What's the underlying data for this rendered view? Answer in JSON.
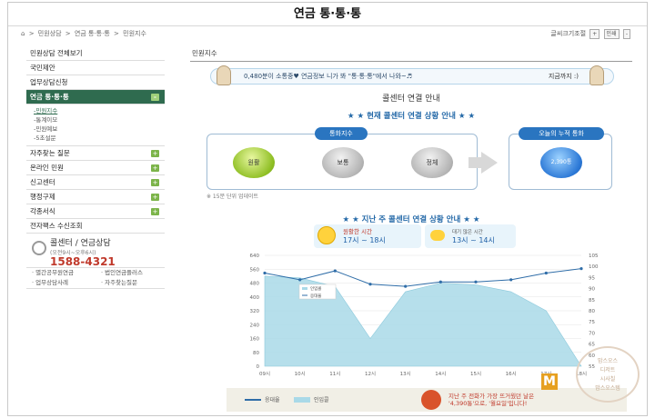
{
  "page": {
    "title": "연금 통·통·통"
  },
  "breadcrumb": [
    "⌂",
    ">",
    "민원상담",
    ">",
    "연금 통·통·통",
    ">",
    "민원지수"
  ],
  "toolbar": {
    "font_label": "글씨크기조절",
    "plus": "+",
    "minus": "-",
    "print": "인쇄"
  },
  "sidebar": {
    "items": [
      {
        "label": "민원상담 전체보기"
      },
      {
        "label": "국민제안"
      },
      {
        "label": "업무상담신청"
      },
      {
        "label": "연금 통·통·통",
        "active": true,
        "plus": "-"
      }
    ],
    "sub": [
      {
        "label": "-민원지수",
        "on": true
      },
      {
        "label": "-통계이모"
      },
      {
        "label": "-민원예보"
      },
      {
        "label": "-5초설문"
      }
    ],
    "items2": [
      {
        "label": "자주찾는 질문",
        "plus": "+"
      },
      {
        "label": "온라인 민원",
        "plus": "+"
      },
      {
        "label": "신고센터",
        "plus": "+"
      },
      {
        "label": "행정구제",
        "plus": "+"
      },
      {
        "label": "각종서식",
        "plus": "+"
      },
      {
        "label": "전자팩스 수신조회"
      }
    ],
    "call": {
      "l1": "콜센터 / 연금상담",
      "l2": "(오전9시~오후6시)",
      "l3": "1588-4321"
    },
    "links": [
      "· 별간공무원연금",
      "· 법인연금플러스",
      "· 업무상담사례",
      "· 자주찾는질문"
    ]
  },
  "main": {
    "tab": "민원지수",
    "banner": {
      "msg": "0,480분이 소통중♥ 연금정보 니가 봐 \"통·통·통\"에서 나와~♬",
      "right": "지금까지 :)"
    },
    "heading": "콜센터 연결 안내",
    "subheading": "★ ★ 현재 콜센터 연결 상황 안내 ★ ★",
    "status": {
      "tag": "통화지수",
      "levels": [
        "원활",
        "보통",
        "정체"
      ],
      "current": "원활",
      "colors": {
        "active": "#8fbf24",
        "inactive": "#b5b5b5"
      }
    },
    "total": {
      "tag": "오늘의 누적 통화",
      "value": "2,390통"
    },
    "note": "※ 15분 단위 업데이트",
    "subheading2": "★ ★ 지난 주 콜센터 연결 상황 안내 ★ ★",
    "peak": {
      "t1": "원활한 시간",
      "t2": "17시 ~ 18시"
    },
    "busy": {
      "t1": "대기 많은 시간",
      "t2": "13시 ~ 14시"
    },
    "bottom": {
      "legend_line": "응대율",
      "legend_area": "인입콜",
      "text1": "지난 주 전화가 가장 뜨거웠던 날은",
      "text2": "'4,390통'으로, '월요일'입니다!"
    },
    "watermark": {
      "badge": "M",
      "circle": [
        "맘스오스",
        "디저트",
        "시사칠",
        "맘스오스템"
      ]
    }
  },
  "chart_data": {
    "type": "area",
    "categories": [
      "09시",
      "10시",
      "11시",
      "12시",
      "13시",
      "14시",
      "15시",
      "16시",
      "17시",
      "18시"
    ],
    "y_left_ticks": [
      "640",
      "560",
      "480",
      "400",
      "320",
      "240",
      "160",
      "80",
      "0"
    ],
    "y_right_ticks": [
      "105",
      "100",
      "95",
      "90",
      "85",
      "80",
      "75",
      "70",
      "65",
      "60",
      "55"
    ],
    "ylim_left": [
      0,
      640
    ],
    "ylim_right": [
      55,
      105
    ],
    "series": [
      {
        "name": "인입콜",
        "axis": "left",
        "color": "#a9d9e8",
        "values": [
          520,
          510,
          460,
          160,
          430,
          480,
          470,
          430,
          320,
          0
        ]
      },
      {
        "name": "응대율",
        "axis": "right",
        "color": "#2f6da8",
        "values": [
          97,
          94,
          98,
          92,
          91,
          93,
          93,
          94,
          97,
          99
        ]
      }
    ],
    "legend": "top-left"
  }
}
